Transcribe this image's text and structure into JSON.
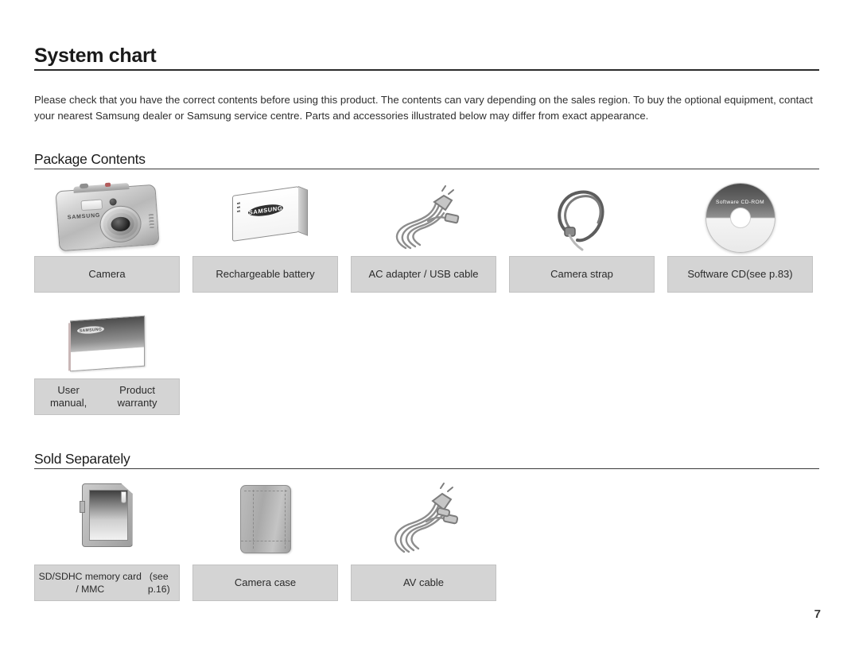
{
  "document": {
    "title": "System chart",
    "intro": "Please check that you have the correct contents before using this product. The contents can vary depending on the sales region. To buy the optional equipment, contact your nearest Samsung dealer or Samsung service centre. Parts and accessories illustrated below may differ from exact appearance.",
    "page_number": "7"
  },
  "sections": [
    {
      "heading": "Package Contents"
    },
    {
      "heading": "Sold Separately"
    }
  ],
  "package_contents": {
    "row1": [
      {
        "label": "Camera",
        "icon": "camera-icon"
      },
      {
        "label": "Rechargeable battery",
        "icon": "battery-icon",
        "brand": "SAMSUNG"
      },
      {
        "label": "AC adapter / USB cable",
        "icon": "cable-icon"
      },
      {
        "label": "Camera strap",
        "icon": "strap-icon"
      },
      {
        "label_line1": "Software CD",
        "label_line2": "(see p.83)",
        "icon": "cd-icon",
        "disc_text": "Software CD-ROM"
      }
    ],
    "row2": [
      {
        "label_line1": "User manual,",
        "label_line2": "Product warranty",
        "icon": "manual-icon",
        "brand": "SAMSUNG"
      }
    ]
  },
  "sold_separately": {
    "row3": [
      {
        "label_line1": "SD/SDHC memory card / MMC",
        "label_line2": "(see p.16)",
        "icon": "sd-card-icon"
      },
      {
        "label": "Camera case",
        "icon": "camera-case-icon"
      },
      {
        "label": "AV cable",
        "icon": "av-cable-icon"
      }
    ]
  },
  "camera_art": {
    "brand": "SAMSUNG"
  },
  "colors": {
    "caption_background": "#d4d4d4",
    "text": "#2b2b2b",
    "rule": "#2b2b2b"
  }
}
